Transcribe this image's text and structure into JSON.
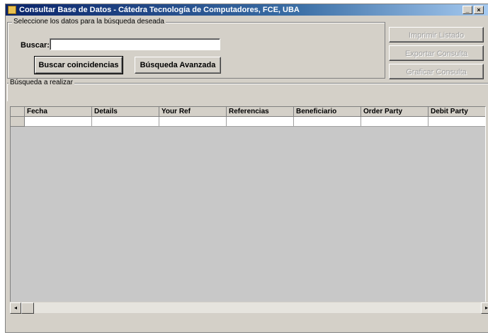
{
  "window": {
    "title": "Consultar Base de Datos - Cátedra Tecnología de Computadores, FCE, UBA",
    "controls": {
      "minimize": "_",
      "close": "×"
    }
  },
  "search_group": {
    "legend": "Seleccione los datos para la búsqueda deseada",
    "search_label": "Buscar:",
    "search_value": "",
    "find_button": "Buscar coincidencias",
    "advanced_button": "Búsqueda Avanzada"
  },
  "actions": {
    "print": "Imprimir Listado",
    "export": "Exportar Consulta",
    "graph": "Graficar Consulta"
  },
  "criteria_group": {
    "legend": "Búsqueda a realizar"
  },
  "grid": {
    "columns": [
      "Fecha",
      "Details",
      "Your Ref",
      "Referencias",
      "Beneficiario",
      "Order Party",
      "Debit Party"
    ]
  },
  "scrollbar": {
    "left_arrow": "◂",
    "right_arrow": "▸"
  }
}
